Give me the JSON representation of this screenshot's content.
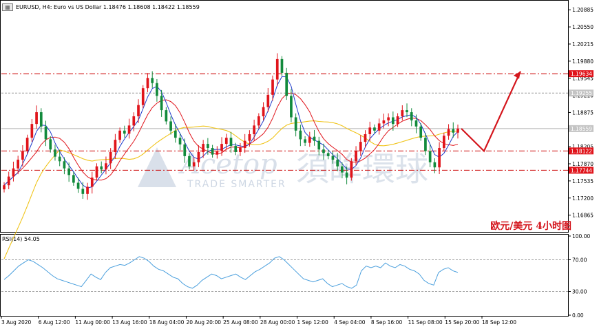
{
  "header": {
    "symbol_line": "EURUSD, H4:  Euro vs US Dollar  1.18476 1.18608 1.18422 1.18559",
    "icon": "chart-window-icon"
  },
  "rsi": {
    "label": "RSI(14) 54.05"
  },
  "annotation": {
    "text": "欧元/美元    4小时图"
  },
  "watermark": {
    "brand": "Acetop",
    "tagline": "TRADE SMARTER",
    "chinese": "須眸環球"
  },
  "colors": {
    "bull": "#e0141b",
    "bear": "#128a3c",
    "ma_fast": "#1f3ccc",
    "ma_mid": "#e0141b",
    "ma_slow": "#f0c419",
    "rsi_line": "#4a9fdd",
    "level_line": "#cc0000",
    "arrow": "#d4151c",
    "grid": "#c8c8c8"
  },
  "chart_data": {
    "type": "candlestick",
    "symbol": "EURUSD",
    "timeframe": "H4",
    "title": "EURUSD, H4:  Euro vs US Dollar",
    "ohlc_last": {
      "open": 1.18476,
      "high": 1.18608,
      "low": 1.18422,
      "close": 1.18559
    },
    "ylim": [
      1.1655,
      1.2105
    ],
    "y_ticks": [
      "1.20885",
      "1.20550",
      "1.20215",
      "1.19880",
      "1.19545",
      "1.19210",
      "1.18875",
      "1.18540",
      "1.18205",
      "1.17870",
      "1.17535",
      "1.17200",
      "1.16865"
    ],
    "x_ticks": [
      "3 Aug 2020",
      "6 Aug 12:00",
      "11 Aug 00:00",
      "13 Aug 16:00",
      "18 Aug 04:00",
      "20 Aug 20:00",
      "25 Aug 08:00",
      "28 Aug 00:00",
      "1 Sep 12:00",
      "4 Sep 04:00",
      "8 Sep 16:00",
      "11 Sep 08:00",
      "15 Sep 20:00",
      "18 Sep 12:00"
    ],
    "levels": [
      {
        "value": 1.19634,
        "label": "1.19634",
        "style": "dash-dot-red",
        "tag": "red"
      },
      {
        "value": 1.19255,
        "label": "1.19255",
        "style": "dashed-gray",
        "tag": "gray"
      },
      {
        "value": 1.18559,
        "label": "1.18559",
        "style": "solid-gray",
        "tag": "gray"
      },
      {
        "value": 1.18122,
        "label": "1.18122",
        "style": "dash-dot-red",
        "tag": "red"
      },
      {
        "value": 1.17744,
        "label": "1.17744",
        "style": "dash-dot-red",
        "tag": "red"
      }
    ],
    "closes": [
      1.1745,
      1.1762,
      1.1778,
      1.1795,
      1.1812,
      1.1838,
      1.1865,
      1.1888,
      1.186,
      1.1835,
      1.1815,
      1.1801,
      1.1792,
      1.1778,
      1.1765,
      1.175,
      1.1738,
      1.1728,
      1.1742,
      1.176,
      1.1782,
      1.1776,
      1.1788,
      1.181,
      1.1834,
      1.1852,
      1.1846,
      1.1862,
      1.188,
      1.1902,
      1.1935,
      1.1955,
      1.1945,
      1.192,
      1.1892,
      1.187,
      1.1852,
      1.1838,
      1.1825,
      1.1802,
      1.1782,
      1.179,
      1.181,
      1.1826,
      1.1818,
      1.1805,
      1.1812,
      1.1826,
      1.1838,
      1.1822,
      1.181,
      1.1818,
      1.1832,
      1.1845,
      1.1862,
      1.188,
      1.1898,
      1.1922,
      1.1952,
      1.1992,
      1.1965,
      1.192,
      1.1878,
      1.1852,
      1.1835,
      1.1828,
      1.184,
      1.1832,
      1.1815,
      1.1808,
      1.1802,
      1.1795,
      1.1782,
      1.177,
      1.176,
      1.1792,
      1.1812,
      1.183,
      1.1845,
      1.1858,
      1.1852,
      1.1866,
      1.1872,
      1.1878,
      1.1865,
      1.188,
      1.1892,
      1.1888,
      1.1872,
      1.186,
      1.1838,
      1.1812,
      1.179,
      1.178,
      1.1818,
      1.1842,
      1.1855,
      1.1848,
      1.1856
    ],
    "series": [
      {
        "name": "EURUSD",
        "kind": "candles"
      },
      {
        "kind": "moving-average-fast",
        "color": "#1f3ccc"
      },
      {
        "kind": "moving-average-mid",
        "color": "#e0141b"
      },
      {
        "kind": "moving-average-slow",
        "color": "#f0c419"
      }
    ],
    "forecast_arrow": {
      "from": 1.18559,
      "low": 1.1812,
      "target": 1.1968,
      "direction": "down-then-up"
    },
    "rsi_panel": {
      "name": "RSI(14)",
      "value": 54.05,
      "ylim": [
        0,
        100
      ],
      "y_ticks": [
        "100.00",
        "70.00",
        "30.00",
        "0.00"
      ],
      "levels": [
        70,
        30
      ],
      "values": [
        45,
        50,
        56,
        62,
        66,
        70,
        68,
        64,
        60,
        55,
        50,
        46,
        44,
        42,
        40,
        38,
        36,
        44,
        52,
        48,
        45,
        54,
        60,
        62,
        64,
        63,
        66,
        70,
        74,
        72,
        68,
        62,
        58,
        56,
        52,
        48,
        46,
        40,
        36,
        34,
        38,
        44,
        48,
        52,
        50,
        46,
        48,
        50,
        52,
        48,
        45,
        50,
        55,
        58,
        62,
        66,
        72,
        74,
        70,
        64,
        58,
        52,
        46,
        44,
        42,
        44,
        46,
        40,
        36,
        38,
        40,
        36,
        34,
        38,
        56,
        62,
        60,
        62,
        60,
        66,
        62,
        60,
        64,
        62,
        58,
        56,
        52,
        44,
        40,
        38,
        54,
        58,
        60,
        56,
        54
      ]
    }
  }
}
